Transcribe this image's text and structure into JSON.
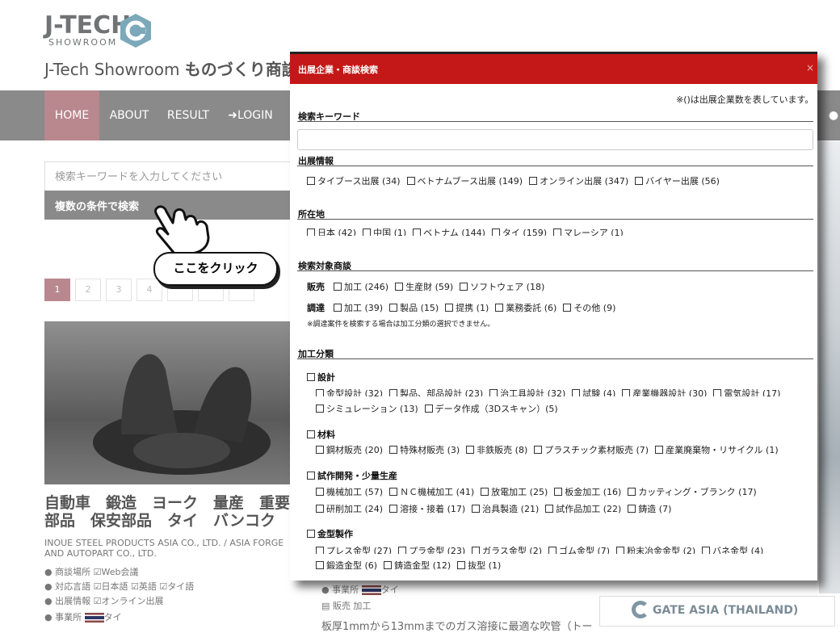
{
  "site": {
    "logo_text": "J-TECH",
    "logo_sub": "SHOWROOM",
    "title_prefix": "J-Tech Showroom ",
    "title_bold": "ものづくり商談会",
    "nav": [
      "HOME",
      "ABOUT",
      "RESULT",
      "LOGIN"
    ],
    "search_placeholder": "検索キーワードを入力してください",
    "multi_search": "複数の条件で検索",
    "callout": "ここをクリック",
    "pages": [
      "1",
      "2",
      "3",
      "4"
    ],
    "article_title": "自動車　鍛造　ヨーク　量産　重要部品　保安部品　タイ　バンコク",
    "company": "INOUE STEEL PRODUCTS ASIA CO., LTD. / ASIA FORGE AND AUTOPART CO., LTD.",
    "meta_place_label": "商談場所",
    "meta_place": "Web会議",
    "meta_lang_label": "対応言語",
    "meta_langs": [
      "日本語",
      "英語",
      "タイ語"
    ],
    "meta_exhibit_label": "出展情報",
    "meta_exhibit": "オンライン出展",
    "meta_office_label": "事業所",
    "meta_office": "タイ",
    "meta2_office_label": "事業所",
    "meta2_office": "タイ",
    "meta2_sales": "販売",
    "meta2_proc": "加工",
    "gate_label": "GATE ASIA (THAILAND)",
    "bottom_text": "板厚1mmから13mmまでのガス溶接に最適な吹管（トー"
  },
  "modal": {
    "title": "出展企業・商談検索",
    "close": "×",
    "note": "※()は出展企業数を表しています。",
    "keyword_label": "検索キーワード",
    "exhibit_label": "出展情報",
    "exhibit_items": [
      "タイブース出展 (34)",
      "ベトナムブース出展 (149)",
      "オンライン出展 (347)",
      "バイヤー出展 (56)"
    ],
    "location_label": "所在地",
    "location_items": [
      "日本 (42)",
      "中国 (1)",
      "ベトナム (144)",
      "タイ (159)",
      "マレーシア (1)"
    ],
    "target_label": "検索対象商談",
    "sales_label": "販売",
    "sales_items": [
      "加工 (246)",
      "生産財 (59)",
      "ソフトウェア (18)"
    ],
    "procure_label": "調達",
    "procure_items": [
      "加工 (39)",
      "製品 (15)",
      "提携 (1)",
      "業務委託 (6)",
      "その他 (9)"
    ],
    "procure_note": "※調達案件を検索する場合は加工分類の選択できません。",
    "proc_label": "加工分類",
    "design_label": "設計",
    "design_row1": [
      "金型設計 (32)",
      "製品、部品設計 (23)",
      "治工具設計 (32)",
      "試験 (4)",
      "産業機器設計 (30)",
      "電気設計 (17)"
    ],
    "design_row2": [
      "シミュレーション (13)",
      "データ作成（3Dスキャン）(5)"
    ],
    "material_label": "材料",
    "material_row": [
      "鋼材販売 (20)",
      "特殊材販売 (3)",
      "非鉄販売 (8)",
      "プラスチック素材販売 (7)",
      "産業廃棄物・リサイクル (1)"
    ],
    "proto_label": "試作開発・少量生産",
    "proto_row1": [
      "機械加工 (57)",
      "ＮＣ機械加工 (41)",
      "放電加工 (25)",
      "板金加工 (16)",
      "カッティング・ブランク (17)"
    ],
    "proto_row2": [
      "研削加工 (24)",
      "溶接・接着 (17)",
      "治具製造 (21)",
      "試作品加工 (22)",
      "鋳造 (7)"
    ],
    "mold_label": "金型製作",
    "mold_row1": [
      "プレス金型 (27)",
      "プラ金型 (23)",
      "ガラス金型 (2)",
      "ゴム金型 (7)",
      "粉末冶金金型 (2)",
      "バネ金型 (4)"
    ],
    "mold_row2": [
      "鍛造金型 (6)",
      "鋳造金型 (12)",
      "抜型 (1)"
    ]
  }
}
